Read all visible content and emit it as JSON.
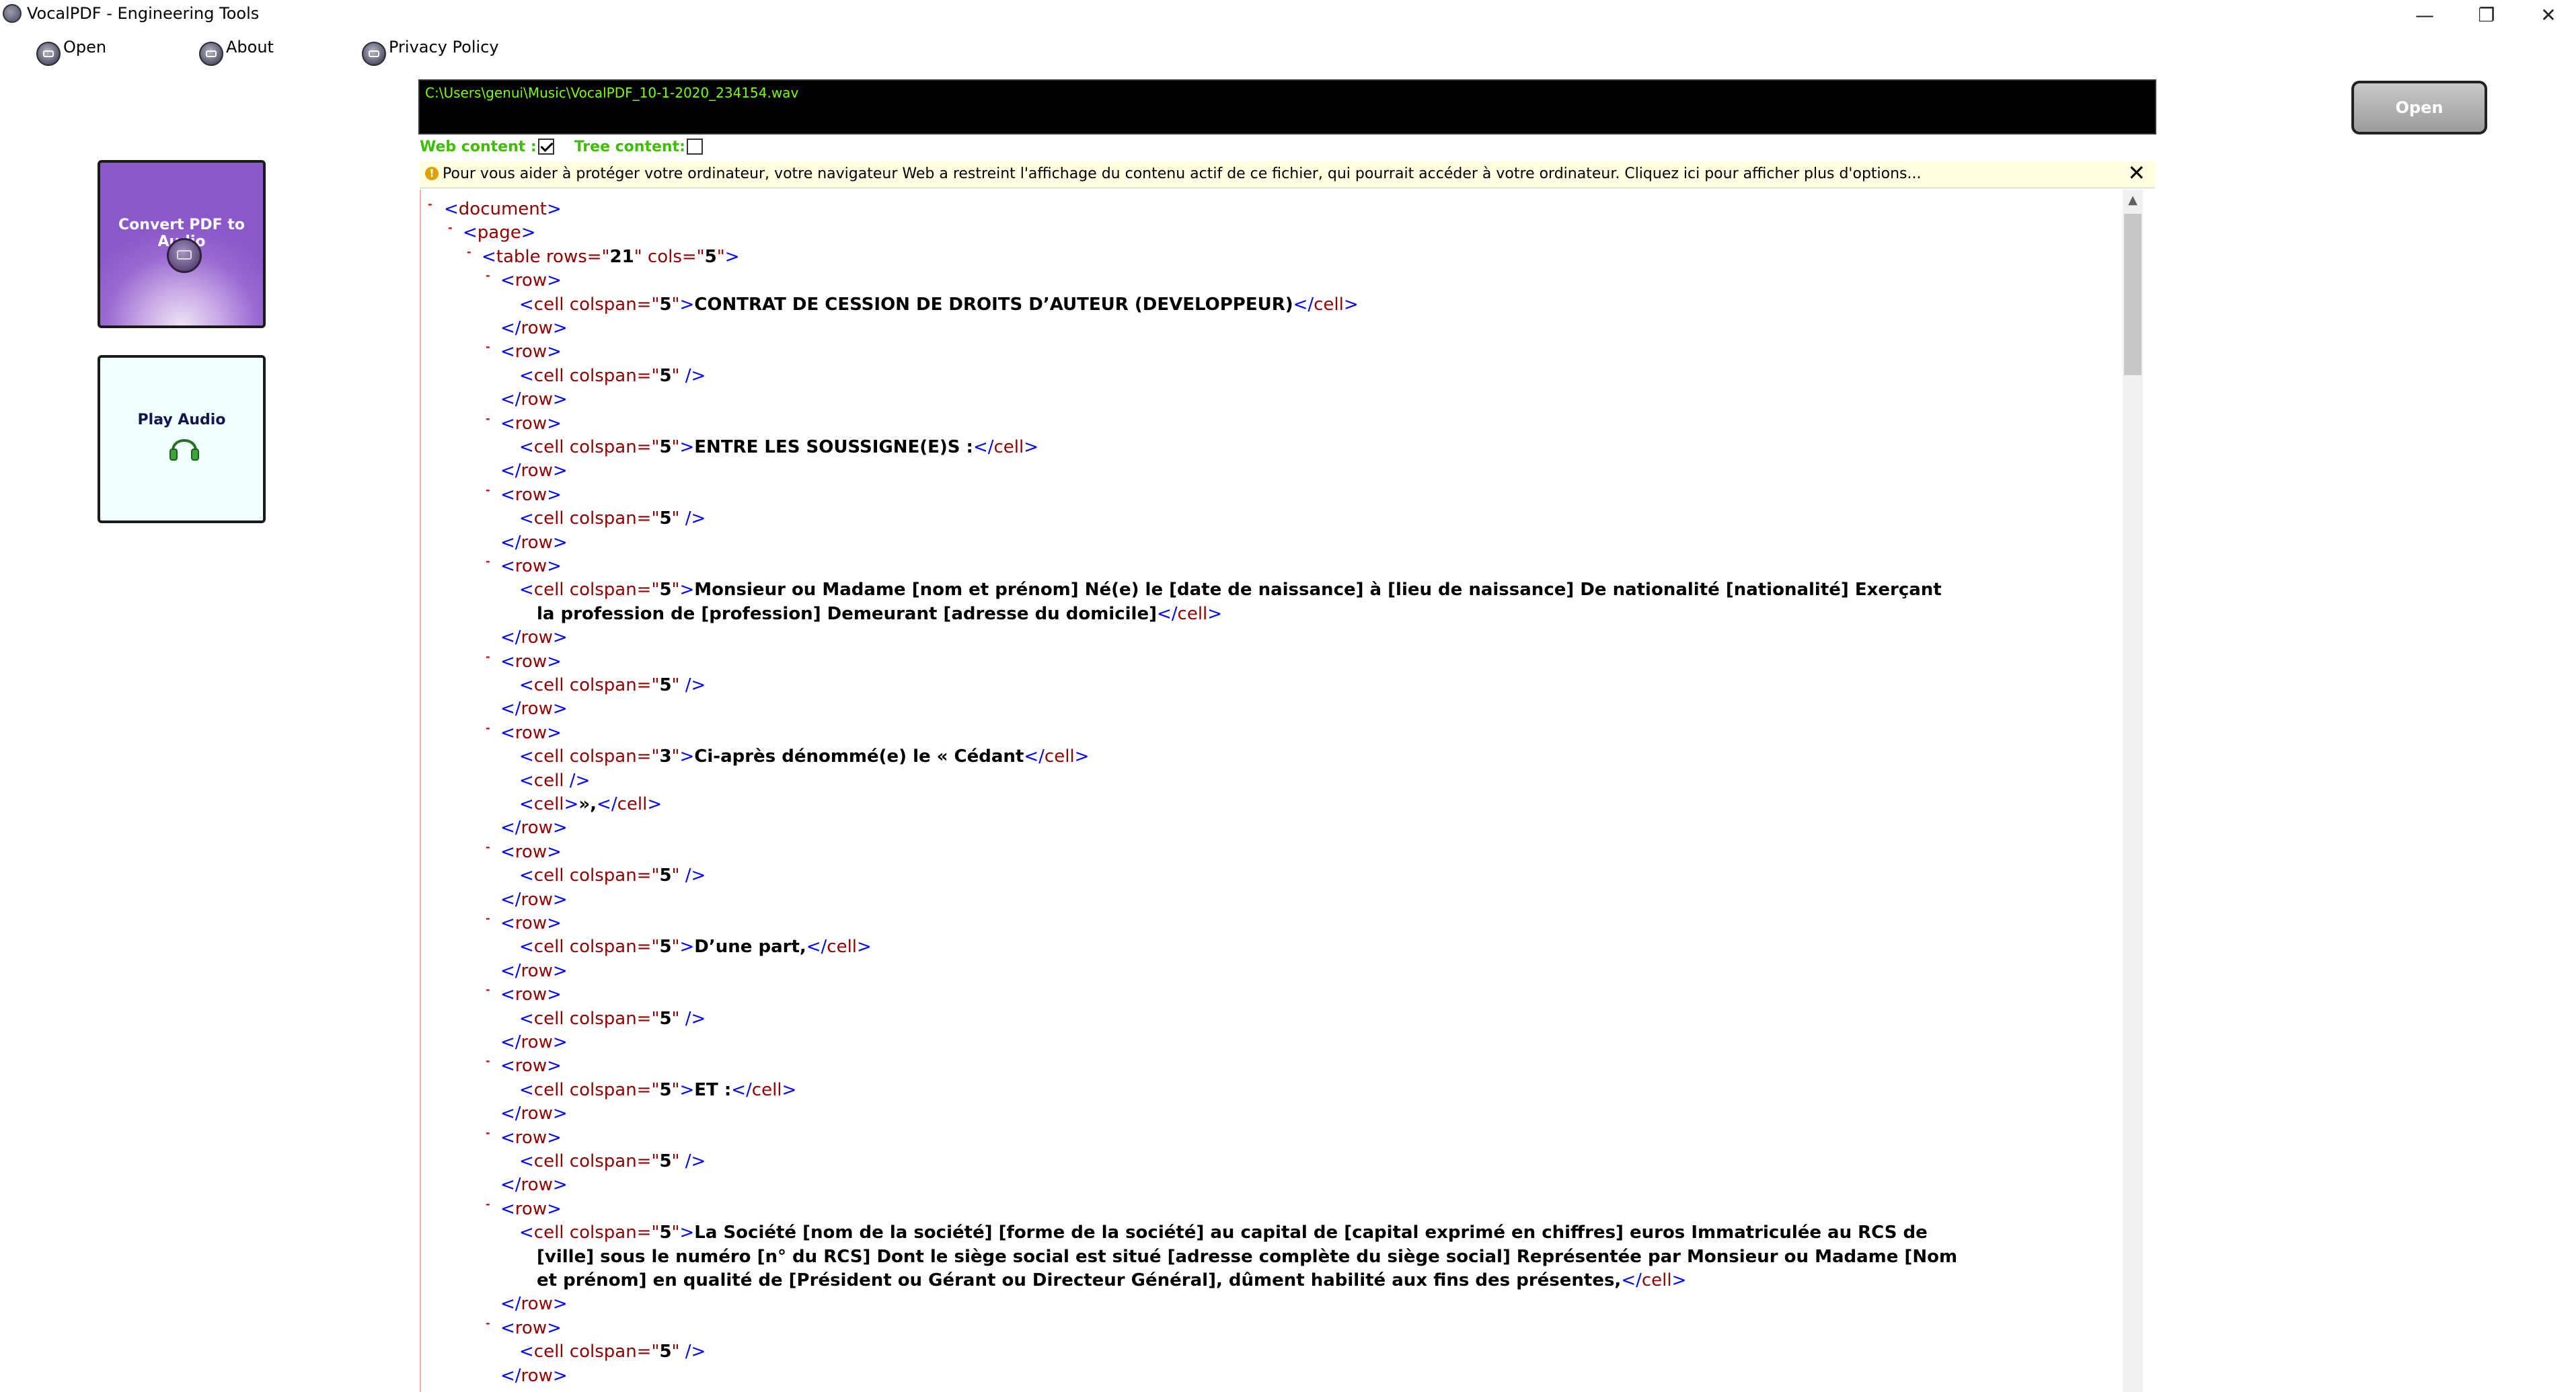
{
  "window": {
    "title": "VocalPDF - Engineering Tools",
    "controls": {
      "minimize": "—",
      "restore": "❐",
      "close": "✕"
    }
  },
  "menu": [
    {
      "label": "Open",
      "icon": "pdf-disc-icon"
    },
    {
      "label": "About",
      "icon": "pdf-disc-icon"
    },
    {
      "label": "Privacy Policy",
      "icon": "pdf-disc-icon"
    }
  ],
  "tiles": {
    "convert": {
      "label": "Convert PDF to Audio",
      "icon": "pdf-disc-icon"
    },
    "play": {
      "label": "Play Audio",
      "icon": "headphones-icon"
    }
  },
  "file_path": "C:\\Users\\genui\\Music\\VocalPDF_10-1-2020_234154.wav",
  "open_button": "Open",
  "options": {
    "web_content_label": "Web content :",
    "web_content_checked": true,
    "tree_content_label": "Tree content:",
    "tree_content_checked": false
  },
  "infobar": {
    "icon": "!",
    "text": "Pour vous aider à protéger votre ordinateur, votre navigateur Web a restreint l'affichage du contenu actif de ce fichier, qui pourrait accéder à votre ordinateur. Cliquez ici pour afficher plus d'options...",
    "close": "✕"
  },
  "xml": {
    "document": "document",
    "page": "page",
    "table": {
      "tag": "table",
      "rows_attr": "rows",
      "rows": "21",
      "cols_attr": "cols",
      "cols": "5"
    },
    "row": "row",
    "cell": "cell",
    "colspan": "colspan",
    "cells": [
      {
        "colspan": "5",
        "text": "CONTRAT DE CESSION DE DROITS D’AUTEUR (DEVELOPPEUR)"
      },
      {
        "colspan": "5",
        "text": ""
      },
      {
        "colspan": "5",
        "text": "ENTRE LES SOUSSIGNE(E)S :"
      },
      {
        "colspan": "5",
        "text": ""
      },
      {
        "colspan": "5",
        "text": "Monsieur ou Madame [nom et prénom] Né(e) le [date de naissance] à [lieu de naissance] De nationalité [nationalité] Exerçant",
        "text2": "la profession de [profession] Demeurant [adresse du domicile]"
      },
      {
        "colspan": "5",
        "text": ""
      },
      {
        "colspan": "3",
        "text": "Ci-après dénommé(e) le « Cédant",
        "extra_empty": "",
        "extra_text": "»,"
      },
      {
        "colspan": "5",
        "text": ""
      },
      {
        "colspan": "5",
        "text": "D’une part,"
      },
      {
        "colspan": "5",
        "text": ""
      },
      {
        "colspan": "5",
        "text": "ET :"
      },
      {
        "colspan": "5",
        "text": ""
      },
      {
        "colspan": "5",
        "text": "La Société [nom de la société] [forme de la société] au capital de [capital exprimé en chiffres] euros Immatriculée au RCS de",
        "text2": "[ville] sous le numéro [n° du RCS] Dont le siège social est situé [adresse complète du siège social] Représentée par Monsieur ou Madame [Nom",
        "text3": "et prénom] en qualité de [Président ou Gérant ou Directeur Général], dûment habilité aux fins des présentes,"
      },
      {
        "colspan": "5",
        "text": ""
      }
    ]
  }
}
